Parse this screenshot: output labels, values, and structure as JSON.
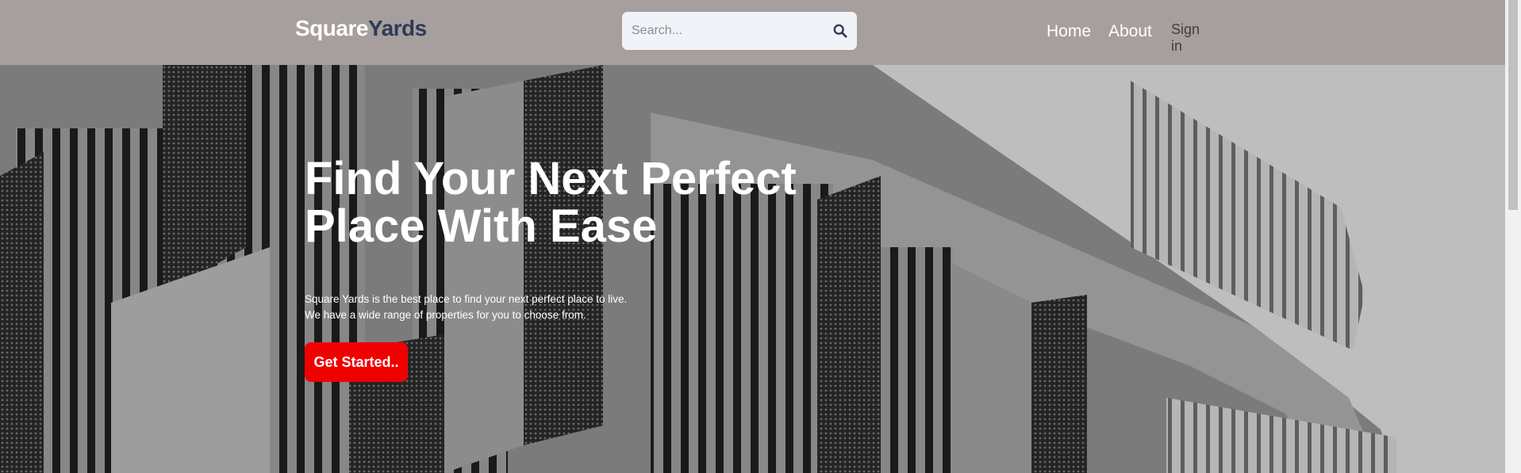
{
  "header": {
    "logo": {
      "part1": "Square",
      "part2": "Yards"
    },
    "search": {
      "placeholder": "Search...",
      "value": "",
      "icon": "search-icon"
    },
    "nav": {
      "home_label": "Home",
      "about_label": "About",
      "signin_label": "Sign in"
    }
  },
  "hero": {
    "title_line1": "Find Your Next Perfect",
    "title_line2": "Place With Ease",
    "subtitle_line1": "Square Yards is the best place to find your next perfect place to live.",
    "subtitle_line2": "We have a wide range of properties for you to choose from.",
    "cta_label": "Get Started.."
  },
  "colors": {
    "header_bg": "#a69f9d",
    "logo_accent": "#2f3a56",
    "cta_bg": "#f10000"
  }
}
